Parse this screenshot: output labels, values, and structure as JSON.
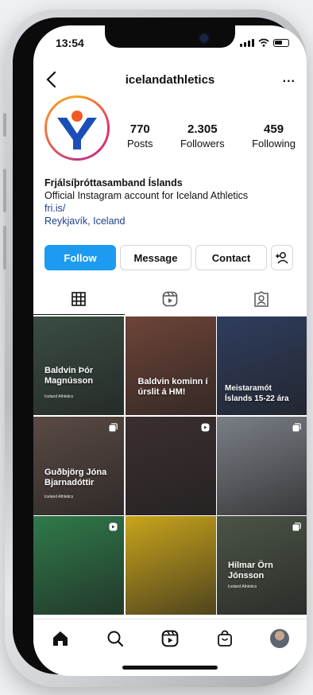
{
  "status_bar": {
    "time": "13:54"
  },
  "header": {
    "username": "icelandathletics",
    "more_label": "..."
  },
  "profile": {
    "stats": [
      {
        "value": "770",
        "label": "Posts"
      },
      {
        "value": "2.305",
        "label": "Followers"
      },
      {
        "value": "459",
        "label": "Following"
      }
    ],
    "name": "Frjálsíþróttasamband Íslands",
    "bio": "Official Instagram account for Iceland Athletics",
    "link": "fri.is/",
    "location": "Reykjavík, Iceland"
  },
  "actions": {
    "follow": "Follow",
    "message": "Message",
    "contact": "Contact"
  },
  "posts": [
    {
      "text": "Baldvin Þór Magnússon",
      "sub": "Iceland Athletics",
      "bg": "#3a4d43",
      "multi": false
    },
    {
      "text": "Baldvin kominn í úrslit á HM!",
      "sub": "",
      "bg": "#6e4438",
      "multi": false
    },
    {
      "text": "Meistaramót Íslands 15-22 ára",
      "sub": "",
      "bg": "#2f3d5e",
      "multi": false
    },
    {
      "text": "Guðbjörg Jóna Bjarnadóttir",
      "sub": "Iceland Athletics",
      "bg": "#5a4a44",
      "multi": true
    },
    {
      "text": "",
      "sub": "",
      "bg": "#3b2f30",
      "multi": true
    },
    {
      "text": "",
      "sub": "",
      "bg": "#7a7f86",
      "multi": true
    },
    {
      "text": "",
      "sub": "",
      "bg": "#2f7a4a",
      "multi": true
    },
    {
      "text": "",
      "sub": "",
      "bg": "#c9a41c",
      "multi": false
    },
    {
      "text": "Hilmar Örn Jónsson",
      "sub": "Iceland Athletics",
      "bg": "#4b5446",
      "multi": true
    }
  ],
  "colors": {
    "accent": "#1d9bf0",
    "logo_blue": "#1b4fb7",
    "logo_orange": "#f05a22"
  }
}
